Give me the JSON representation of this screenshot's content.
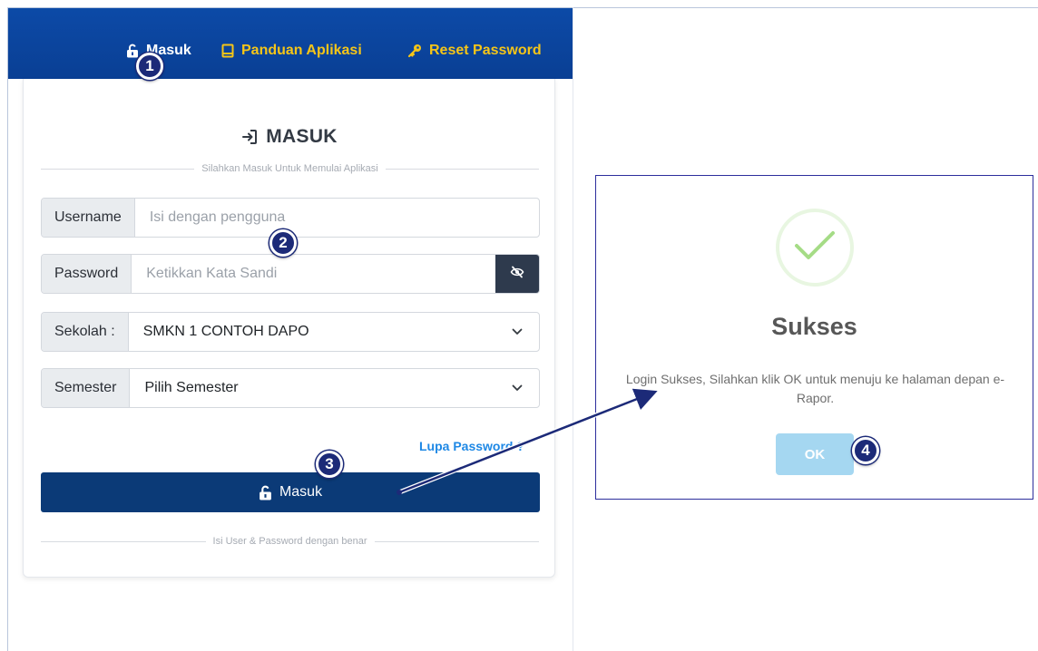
{
  "nav": {
    "masuk": "Masuk",
    "panduan": "Panduan Aplikasi",
    "reset": "Reset Password"
  },
  "login": {
    "title": "MASUK",
    "subtitle": "Silahkan Masuk Untuk Memulai Aplikasi",
    "username_label": "Username",
    "username_placeholder": "Isi dengan pengguna",
    "password_label": "Password",
    "password_placeholder": "Ketikkan Kata Sandi",
    "sekolah_label": "Sekolah :",
    "sekolah_value": "SMKN 1 CONTOH DAPO",
    "semester_label": "Semester",
    "semester_value": "Pilih Semester",
    "forgot_link": "Lupa Password ?",
    "submit_label": "Masuk",
    "footer_hint": "Isi User & Password dengan benar"
  },
  "modal": {
    "title": "Sukses",
    "message": "Login Sukses, Silahkan klik OK untuk menuju ke halaman depan e-Rapor.",
    "ok_label": "OK"
  },
  "steps": [
    "1",
    "2",
    "3",
    "4"
  ],
  "colors": {
    "header": "#0c4aa7",
    "nav_accent": "#f5c518",
    "submit_button": "#0b3a77",
    "link": "#1e88e5",
    "ok_button": "#a5d7f1",
    "success_check": "#a5dc86",
    "step_badge": "#1c2a78"
  },
  "icons": {
    "masuk": "unlock-icon",
    "panduan": "book-icon",
    "reset": "key-icon",
    "title": "sign-in-icon",
    "password_toggle": "eye-slash-icon",
    "select": "chevron-down-icon",
    "success": "check-icon"
  }
}
